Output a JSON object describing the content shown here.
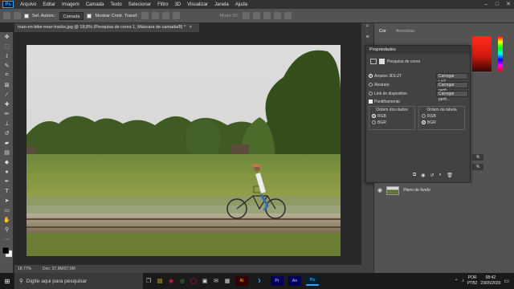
{
  "menubar": {
    "logo": "Ps",
    "items": [
      "Arquivo",
      "Editar",
      "Imagem",
      "Camada",
      "Texto",
      "Selecionar",
      "Filtro",
      "3D",
      "Visualizar",
      "Janela",
      "Ajuda"
    ]
  },
  "options": {
    "auto_select_label": "Sel. Autom.:",
    "layer_dropdown": "Camada",
    "transform_label": "Mostrar Contr. Transf.",
    "mode3d": "Modo 3D:"
  },
  "document": {
    "tab_title": "man-on-bike-near-tracks.jpg @ 18,8% (Pesquisa de cores 1, Máscara de camada/8) *",
    "tab_close": "×"
  },
  "status": {
    "zoom": "18,77%",
    "doc_info": "Doc: 37,9M/37,9M"
  },
  "panels": {
    "color_tab": "Cor",
    "swatches_tab": "Amostras",
    "properties_title": "Propriedades",
    "lookup_label": "Pesquisa de cores",
    "options": [
      {
        "label": "Arquivo 3DLUT",
        "selected": true,
        "button": "Carregar LUT..."
      },
      {
        "label": "Abstrato",
        "selected": false,
        "button": "Carregar perfi..."
      },
      {
        "label": "Link de dispositivo",
        "selected": false,
        "button": "Carregar perfi..."
      }
    ],
    "dither_label": "Pontilhamento",
    "data_order_label": "Ordem dos dados",
    "table_order_label": "Ordem da tabela",
    "data_order": [
      "RGB",
      "BGR"
    ],
    "table_order": [
      "RGB",
      "BGR"
    ],
    "layer_name": "Plano de fundo"
  },
  "taskbar": {
    "search_placeholder": "Digite aqui para pesquisar",
    "lang": "POR",
    "layout": "PTB2",
    "time": "08:42",
    "date": "23/05/2020",
    "apps": [
      {
        "name": "Ai",
        "color": "#330000",
        "fg": "#ff9a00"
      },
      {
        "name": "Pr",
        "color": "#00005b",
        "fg": "#9999ff"
      },
      {
        "name": "Ae",
        "color": "#00005b",
        "fg": "#9999ff"
      },
      {
        "name": "Ps",
        "color": "#001e36",
        "fg": "#31a8ff"
      }
    ]
  },
  "colors": {
    "foreground": "#ff2a1a",
    "accent": "#31a8ff"
  }
}
